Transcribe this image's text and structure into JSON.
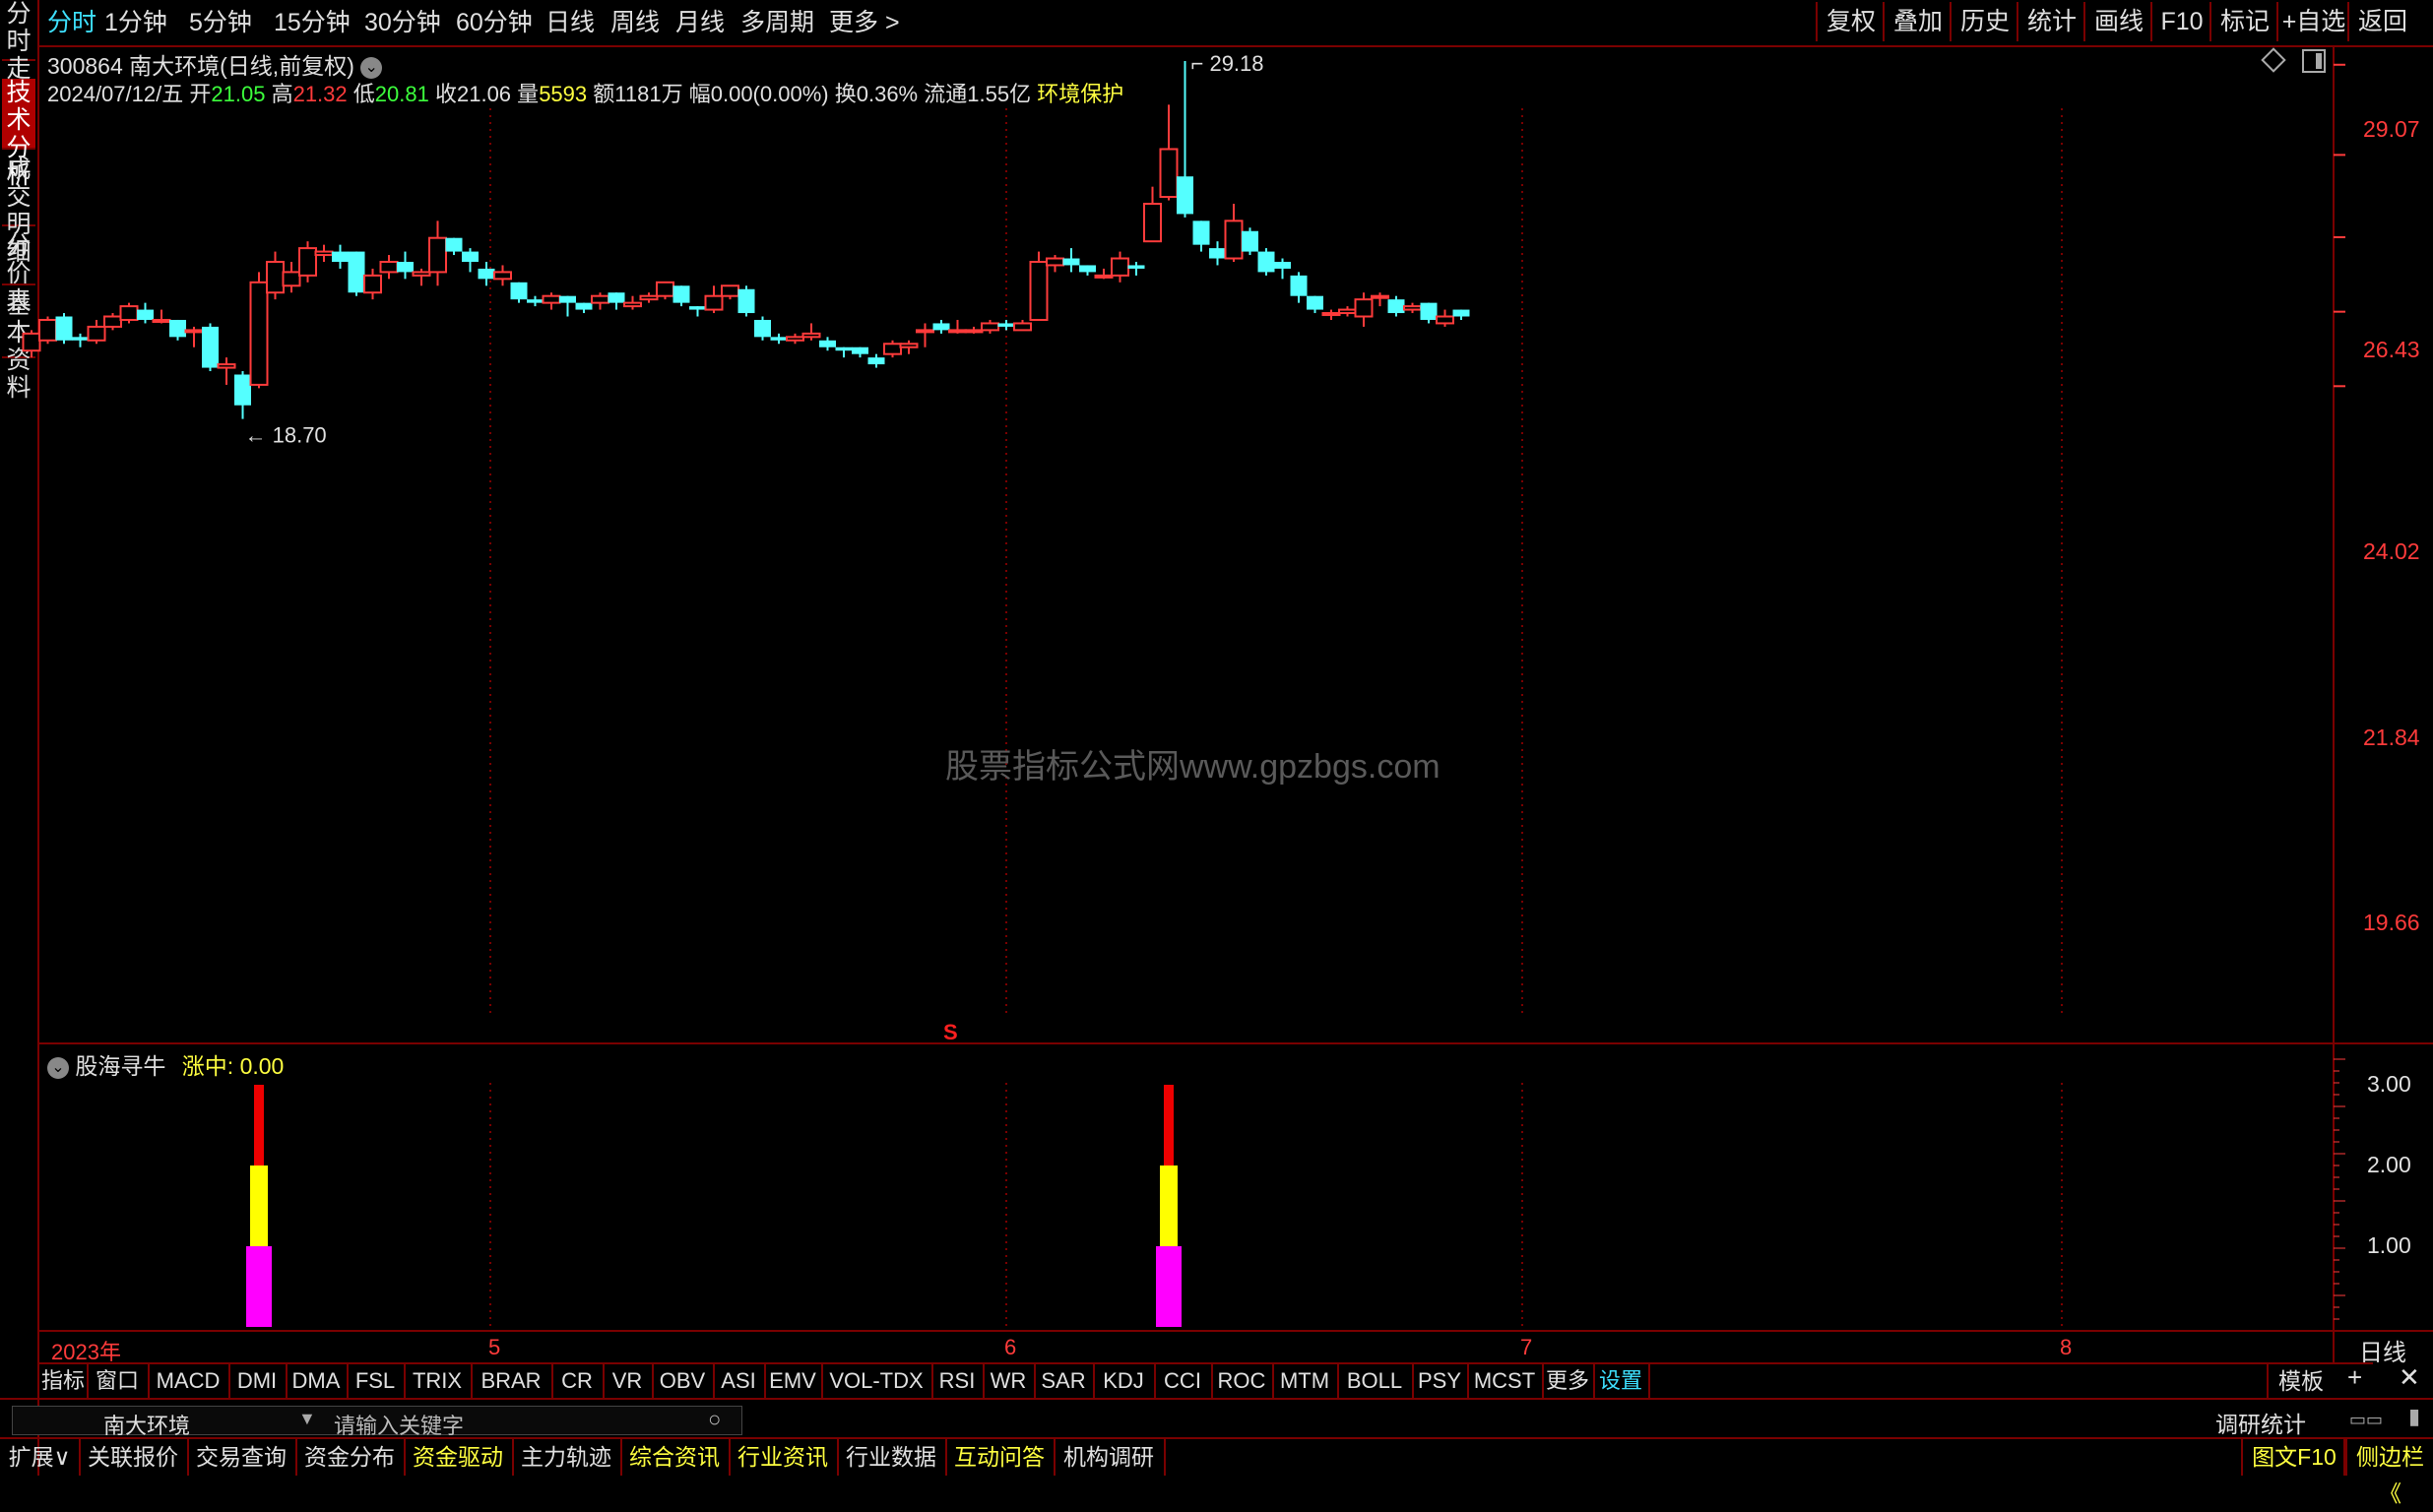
{
  "top_periods": [
    {
      "label": "分时",
      "active": true
    },
    {
      "label": "1分钟"
    },
    {
      "label": "5分钟"
    },
    {
      "label": "15分钟"
    },
    {
      "label": "30分钟"
    },
    {
      "label": "60分钟"
    },
    {
      "label": "日线"
    },
    {
      "label": "周线"
    },
    {
      "label": "月线"
    },
    {
      "label": "多周期"
    },
    {
      "label": "更多 >"
    }
  ],
  "top_right": [
    "复权",
    "叠加",
    "历史",
    "统计",
    "画线",
    "F10",
    "标记",
    "+自选",
    "返回"
  ],
  "left_tabs": [
    "分时走势",
    "技术分析",
    "成交明细",
    "分价表",
    "基本资料"
  ],
  "stock": {
    "code": "300864",
    "name": "南大环境",
    "mode": "(日线,前复权)"
  },
  "quote": {
    "date": "2024/07/12/五",
    "open_label": "开",
    "open": "21.05",
    "high_label": "高",
    "high": "21.32",
    "low_label": "低",
    "low": "20.81",
    "close_label": "收",
    "close": "21.06",
    "vol_label": "量",
    "vol": "5593",
    "amt_label": "额",
    "amt": "1181万",
    "chg_label": "幅",
    "chg": "0.00(0.00%)",
    "turn_label": "换",
    "turn": "0.36%",
    "float_label": "流通",
    "float": "1.55亿",
    "sector": "环境保护"
  },
  "price_axis": [
    "29.07",
    "26.43",
    "24.02",
    "21.84",
    "19.66"
  ],
  "annotations": {
    "high": "29.18",
    "low": "18.70",
    "signal": "S"
  },
  "watermark": "股票指标公式网www.gpzbgs.com",
  "indicator": {
    "name": "股海寻牛",
    "value_label": "涨中:",
    "value": "0.00",
    "axis": [
      "3.00",
      "2.00",
      "1.00"
    ]
  },
  "time_axis": {
    "year": "2023年",
    "months": [
      "5",
      "6",
      "7",
      "8"
    ],
    "period": "日线"
  },
  "indicator_tabs": [
    "指标",
    "窗口",
    "MACD",
    "DMI",
    "DMA",
    "FSL",
    "TRIX",
    "BRAR",
    "CR",
    "VR",
    "OBV",
    "ASI",
    "EMV",
    "VOL-TDX",
    "RSI",
    "WR",
    "SAR",
    "KDJ",
    "CCI",
    "ROC",
    "MTM",
    "BOLL",
    "PSY",
    "MCST",
    "更多",
    "设置"
  ],
  "template_btn": "模板",
  "search": {
    "stock": "南大环境",
    "placeholder": "请输入关键字",
    "right_label": "调研统计"
  },
  "bottom_tabs": [
    {
      "label": "扩展∨",
      "color": "#e0e0e0"
    },
    {
      "label": "关联报价",
      "color": "#e0e0e0"
    },
    {
      "label": "交易查询",
      "color": "#e0e0e0"
    },
    {
      "label": "资金分布",
      "color": "#e0e0e0"
    },
    {
      "label": "资金驱动",
      "color": "#ffff40"
    },
    {
      "label": "主力轨迹",
      "color": "#e0e0e0"
    },
    {
      "label": "综合资讯",
      "color": "#ffff40"
    },
    {
      "label": "行业资讯",
      "color": "#ffff40"
    },
    {
      "label": "行业数据",
      "color": "#e0e0e0"
    },
    {
      "label": "互动问答",
      "color": "#ffff40"
    },
    {
      "label": "机构调研",
      "color": "#e0e0e0"
    }
  ],
  "bottom_right": [
    "图文F10",
    "侧边栏《"
  ],
  "candles": [
    {
      "o": 20.7,
      "c": 21.2,
      "h": 21.3,
      "l": 20.5
    },
    {
      "o": 21.0,
      "c": 21.6,
      "h": 21.7,
      "l": 20.9
    },
    {
      "o": 21.7,
      "c": 21.0,
      "h": 21.8,
      "l": 20.9
    },
    {
      "o": 21.1,
      "c": 21.0,
      "h": 21.2,
      "l": 20.8
    },
    {
      "o": 21.0,
      "c": 21.4,
      "h": 21.6,
      "l": 20.9
    },
    {
      "o": 21.4,
      "c": 21.7,
      "h": 21.8,
      "l": 21.3
    },
    {
      "o": 21.6,
      "c": 22.0,
      "h": 22.1,
      "l": 21.5
    },
    {
      "o": 21.9,
      "c": 21.6,
      "h": 22.1,
      "l": 21.5
    },
    {
      "o": 21.6,
      "c": 21.6,
      "h": 21.9,
      "l": 21.5
    },
    {
      "o": 21.6,
      "c": 21.1,
      "h": 21.6,
      "l": 21.0
    },
    {
      "o": 21.3,
      "c": 21.3,
      "h": 21.4,
      "l": 20.8
    },
    {
      "o": 21.4,
      "c": 20.2,
      "h": 21.5,
      "l": 20.1
    },
    {
      "o": 20.2,
      "c": 20.3,
      "h": 20.5,
      "l": 19.7
    },
    {
      "o": 20.0,
      "c": 19.1,
      "h": 20.1,
      "l": 18.7
    },
    {
      "o": 19.7,
      "c": 22.7,
      "h": 23.0,
      "l": 19.6
    },
    {
      "o": 22.4,
      "c": 23.3,
      "h": 23.6,
      "l": 22.2
    },
    {
      "o": 22.6,
      "c": 23.0,
      "h": 23.3,
      "l": 22.4
    },
    {
      "o": 22.9,
      "c": 23.7,
      "h": 23.9,
      "l": 22.7
    },
    {
      "o": 23.5,
      "c": 23.6,
      "h": 23.8,
      "l": 23.3
    },
    {
      "o": 23.6,
      "c": 23.3,
      "h": 23.8,
      "l": 23.1
    },
    {
      "o": 23.6,
      "c": 22.4,
      "h": 23.6,
      "l": 22.3
    },
    {
      "o": 22.4,
      "c": 22.9,
      "h": 23.1,
      "l": 22.2
    },
    {
      "o": 23.0,
      "c": 23.3,
      "h": 23.5,
      "l": 22.8
    },
    {
      "o": 23.3,
      "c": 23.0,
      "h": 23.6,
      "l": 22.8
    },
    {
      "o": 22.9,
      "c": 23.0,
      "h": 23.1,
      "l": 22.6
    },
    {
      "o": 23.0,
      "c": 24.0,
      "h": 24.5,
      "l": 22.6
    },
    {
      "o": 24.0,
      "c": 23.6,
      "h": 24.0,
      "l": 23.5
    },
    {
      "o": 23.6,
      "c": 23.3,
      "h": 23.7,
      "l": 23.0
    },
    {
      "o": 23.1,
      "c": 22.8,
      "h": 23.3,
      "l": 22.6
    },
    {
      "o": 22.8,
      "c": 23.0,
      "h": 23.2,
      "l": 22.6
    },
    {
      "o": 22.7,
      "c": 22.2,
      "h": 22.7,
      "l": 22.1
    },
    {
      "o": 22.2,
      "c": 22.1,
      "h": 22.3,
      "l": 22.0
    },
    {
      "o": 22.1,
      "c": 22.3,
      "h": 22.4,
      "l": 21.9
    },
    {
      "o": 22.3,
      "c": 22.1,
      "h": 22.3,
      "l": 21.7
    },
    {
      "o": 22.1,
      "c": 21.9,
      "h": 22.1,
      "l": 21.8
    },
    {
      "o": 22.1,
      "c": 22.3,
      "h": 22.4,
      "l": 21.9
    },
    {
      "o": 22.4,
      "c": 22.1,
      "h": 22.4,
      "l": 21.9
    },
    {
      "o": 22.0,
      "c": 22.1,
      "h": 22.3,
      "l": 21.9
    },
    {
      "o": 22.2,
      "c": 22.3,
      "h": 22.4,
      "l": 22.1
    },
    {
      "o": 22.3,
      "c": 22.7,
      "h": 22.7,
      "l": 22.2
    },
    {
      "o": 22.6,
      "c": 22.1,
      "h": 22.6,
      "l": 22.0
    },
    {
      "o": 22.0,
      "c": 21.9,
      "h": 22.0,
      "l": 21.7
    },
    {
      "o": 21.9,
      "c": 22.3,
      "h": 22.6,
      "l": 21.8
    },
    {
      "o": 22.3,
      "c": 22.6,
      "h": 22.6,
      "l": 22.2
    },
    {
      "o": 22.5,
      "c": 21.8,
      "h": 22.6,
      "l": 21.7
    },
    {
      "o": 21.6,
      "c": 21.1,
      "h": 21.7,
      "l": 21.0
    },
    {
      "o": 21.1,
      "c": 21.0,
      "h": 21.2,
      "l": 20.9
    },
    {
      "o": 21.0,
      "c": 21.1,
      "h": 21.2,
      "l": 20.9
    },
    {
      "o": 21.1,
      "c": 21.2,
      "h": 21.5,
      "l": 21.0
    },
    {
      "o": 21.0,
      "c": 20.8,
      "h": 21.1,
      "l": 20.7
    },
    {
      "o": 20.8,
      "c": 20.7,
      "h": 20.8,
      "l": 20.5
    },
    {
      "o": 20.8,
      "c": 20.6,
      "h": 20.8,
      "l": 20.5
    },
    {
      "o": 20.5,
      "c": 20.3,
      "h": 20.6,
      "l": 20.2
    },
    {
      "o": 20.6,
      "c": 20.9,
      "h": 21.0,
      "l": 20.5
    },
    {
      "o": 20.8,
      "c": 20.9,
      "h": 21.0,
      "l": 20.6
    },
    {
      "o": 21.3,
      "c": 21.3,
      "h": 21.5,
      "l": 20.8
    },
    {
      "o": 21.5,
      "c": 21.3,
      "h": 21.6,
      "l": 21.2
    },
    {
      "o": 21.3,
      "c": 21.3,
      "h": 21.6,
      "l": 21.2
    },
    {
      "o": 21.3,
      "c": 21.3,
      "h": 21.4,
      "l": 21.2
    },
    {
      "o": 21.3,
      "c": 21.5,
      "h": 21.6,
      "l": 21.2
    },
    {
      "o": 21.5,
      "c": 21.4,
      "h": 21.6,
      "l": 21.3
    },
    {
      "o": 21.3,
      "c": 21.5,
      "h": 21.6,
      "l": 21.3
    },
    {
      "o": 21.6,
      "c": 23.3,
      "h": 23.6,
      "l": 21.6
    },
    {
      "o": 23.2,
      "c": 23.4,
      "h": 23.5,
      "l": 23.0
    },
    {
      "o": 23.4,
      "c": 23.2,
      "h": 23.7,
      "l": 23.0
    },
    {
      "o": 23.2,
      "c": 23.0,
      "h": 23.2,
      "l": 22.9
    },
    {
      "o": 22.9,
      "c": 22.9,
      "h": 23.1,
      "l": 22.8
    },
    {
      "o": 22.9,
      "c": 23.4,
      "h": 23.6,
      "l": 22.7
    },
    {
      "o": 23.2,
      "c": 23.1,
      "h": 23.3,
      "l": 22.9
    },
    {
      "o": 23.9,
      "c": 25.0,
      "h": 25.5,
      "l": 23.9
    },
    {
      "o": 25.2,
      "c": 26.6,
      "h": 27.9,
      "l": 25.1
    },
    {
      "o": 25.8,
      "c": 24.7,
      "h": 29.18,
      "l": 24.6
    },
    {
      "o": 24.5,
      "c": 23.8,
      "h": 24.5,
      "l": 23.6
    },
    {
      "o": 23.7,
      "c": 23.4,
      "h": 23.9,
      "l": 23.2
    },
    {
      "o": 23.4,
      "c": 24.5,
      "h": 25.0,
      "l": 23.3
    },
    {
      "o": 24.2,
      "c": 23.6,
      "h": 24.3,
      "l": 23.5
    },
    {
      "o": 23.6,
      "c": 23.0,
      "h": 23.7,
      "l": 22.9
    },
    {
      "o": 23.3,
      "c": 23.1,
      "h": 23.4,
      "l": 22.8
    },
    {
      "o": 22.9,
      "c": 22.3,
      "h": 23.0,
      "l": 22.1
    },
    {
      "o": 22.3,
      "c": 21.9,
      "h": 22.3,
      "l": 21.8
    },
    {
      "o": 21.8,
      "c": 21.8,
      "h": 21.9,
      "l": 21.6
    },
    {
      "o": 21.8,
      "c": 21.9,
      "h": 22.0,
      "l": 21.7
    },
    {
      "o": 21.7,
      "c": 22.2,
      "h": 22.4,
      "l": 21.4
    },
    {
      "o": 22.3,
      "c": 22.3,
      "h": 22.4,
      "l": 22.0
    },
    {
      "o": 22.2,
      "c": 21.8,
      "h": 22.3,
      "l": 21.7
    },
    {
      "o": 21.9,
      "c": 22.0,
      "h": 22.1,
      "l": 21.8
    },
    {
      "o": 22.1,
      "c": 21.6,
      "h": 22.1,
      "l": 21.5
    },
    {
      "o": 21.5,
      "c": 21.7,
      "h": 21.9,
      "l": 21.4
    },
    {
      "o": 21.9,
      "c": 21.7,
      "h": 21.9,
      "l": 21.6
    }
  ],
  "signal_bars": [
    {
      "index": 14
    },
    {
      "index": 70
    }
  ],
  "signal_levels": {
    "magenta": 1,
    "yellow": 2,
    "red": 3
  },
  "colors": {
    "up": "#ff3b3b",
    "down": "#54ffff",
    "bg": "#000000",
    "grid": "#7a0000",
    "active": "#3ee0ff",
    "magenta": "#ff00ff",
    "yellow": "#ffff00",
    "red": "#ee0000"
  }
}
